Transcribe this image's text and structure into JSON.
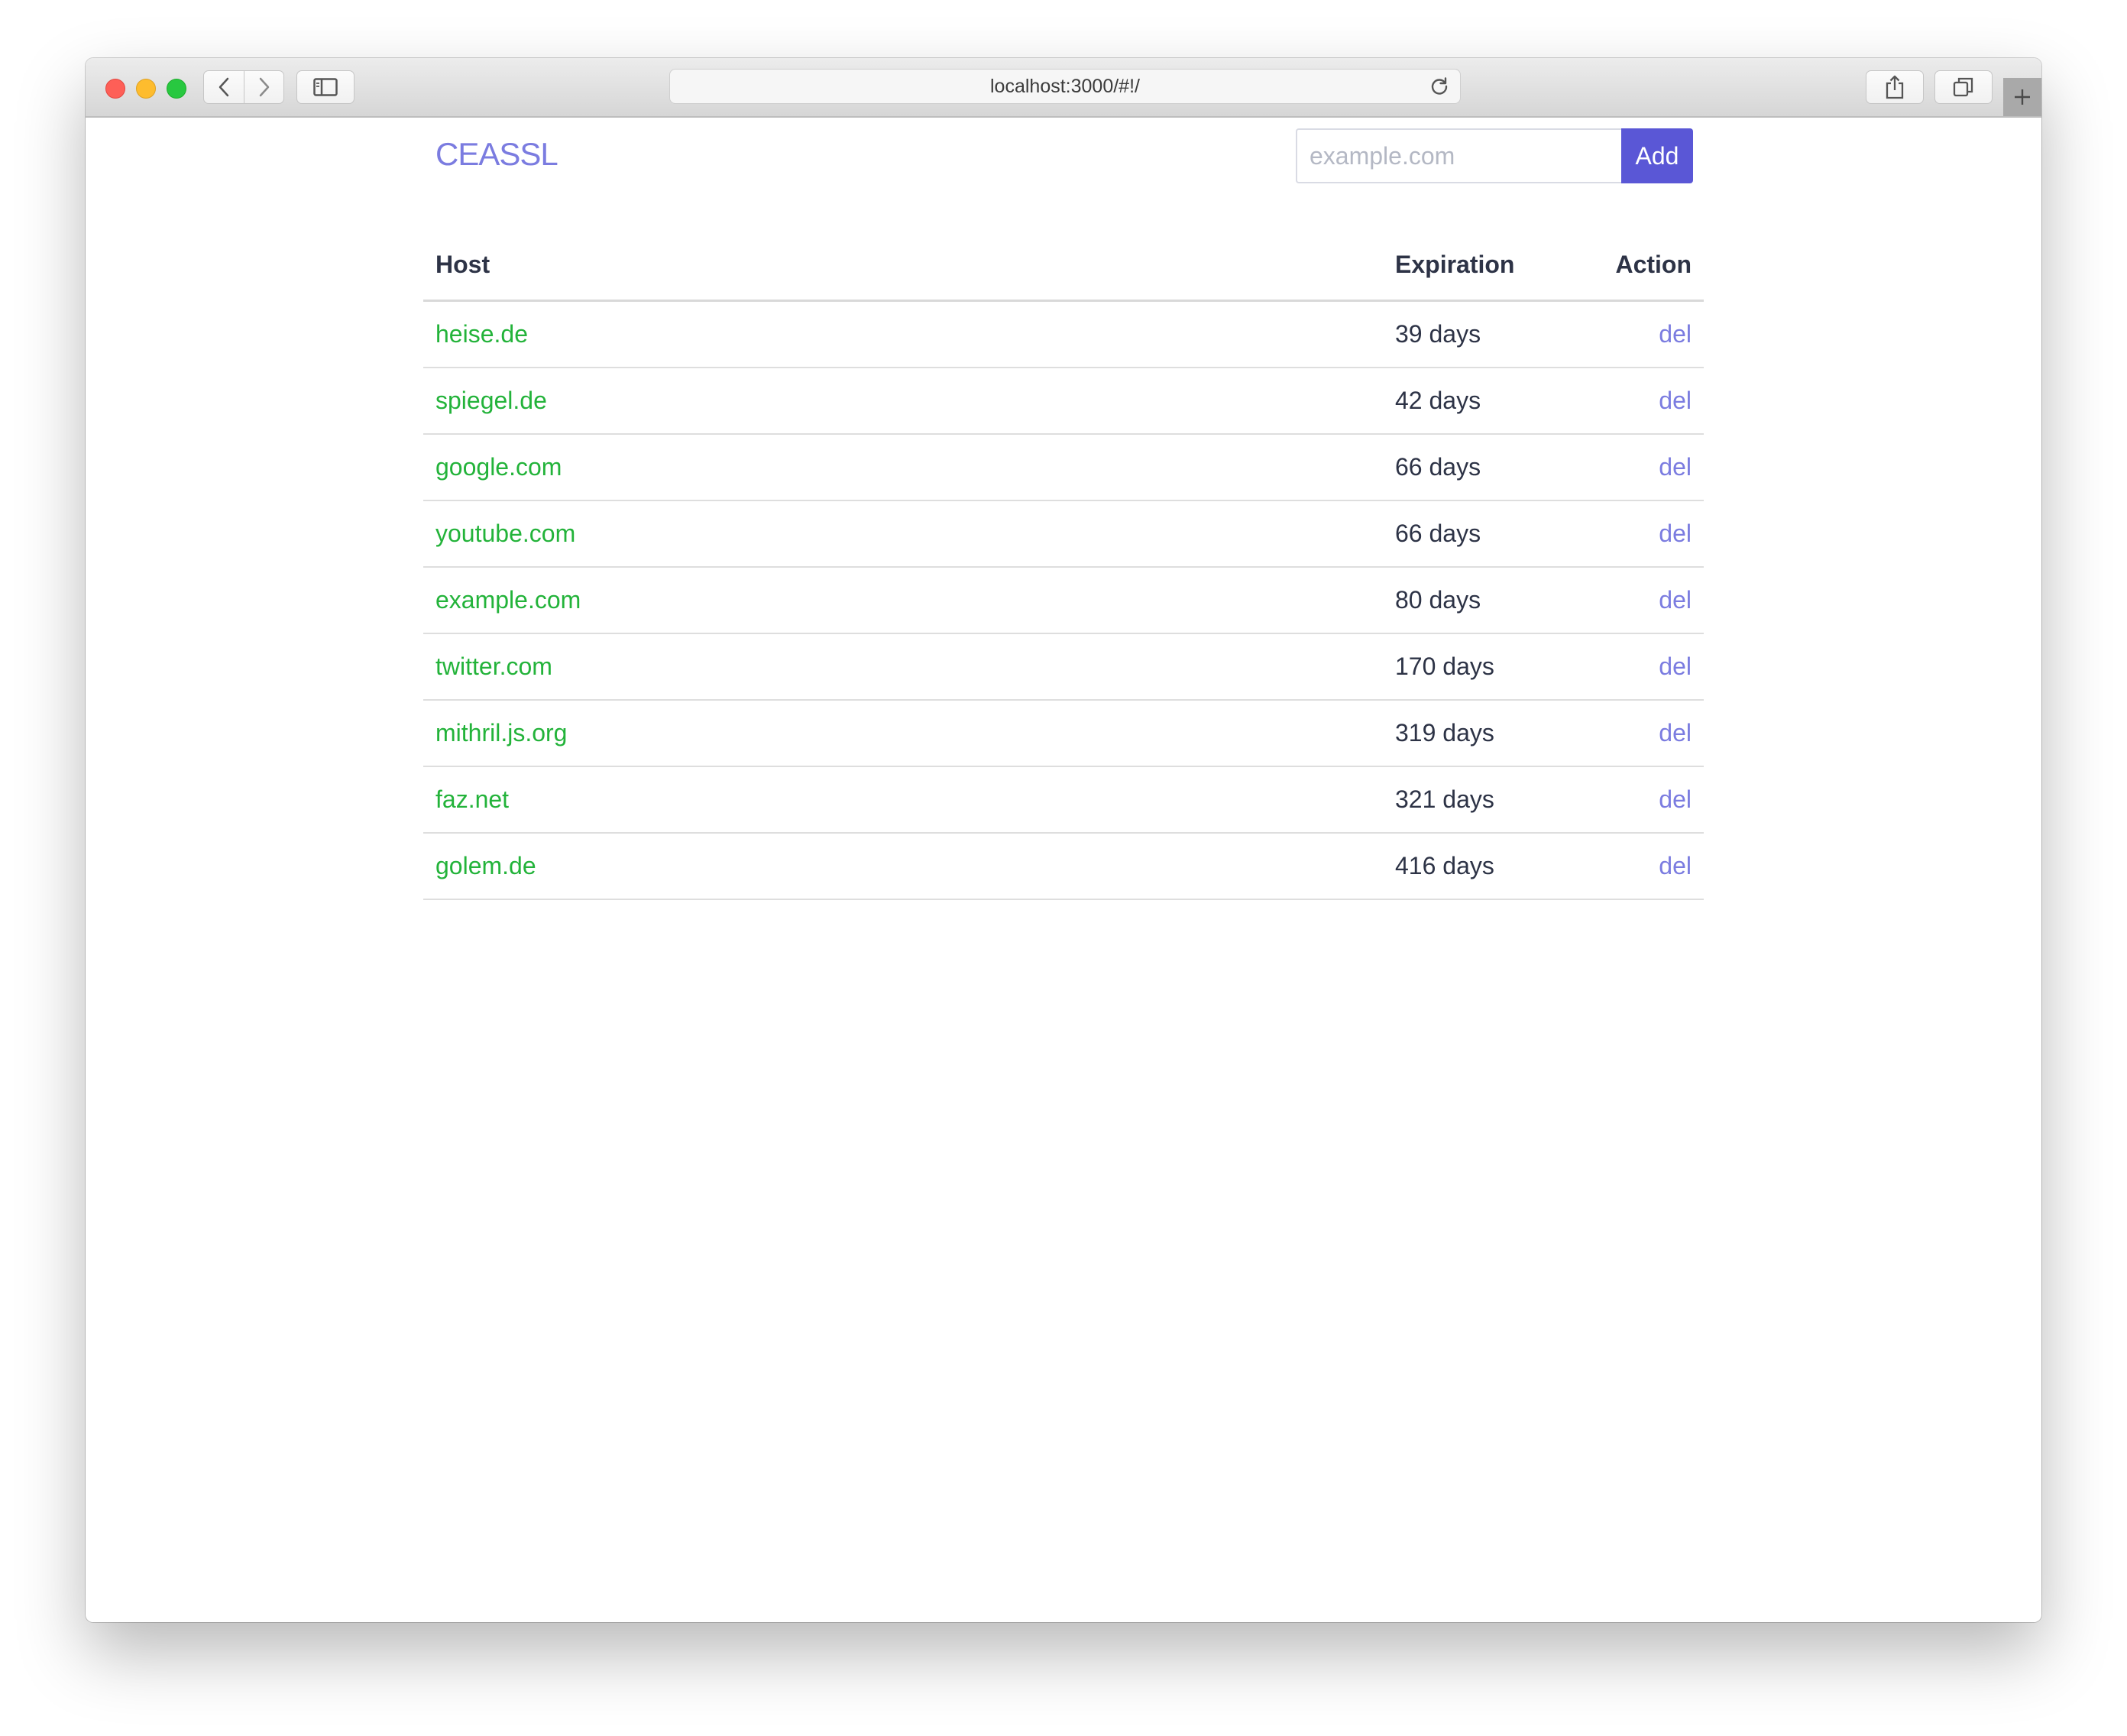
{
  "browser": {
    "url": "localhost:3000/#!/"
  },
  "app": {
    "brand": "CEASSL",
    "add_form": {
      "placeholder": "example.com",
      "value": "",
      "button_label": "Add"
    }
  },
  "table": {
    "headers": {
      "host": "Host",
      "expiration": "Expiration",
      "action": "Action"
    },
    "rows": [
      {
        "host": "heise.de",
        "expiration": "39 days",
        "action": "del"
      },
      {
        "host": "spiegel.de",
        "expiration": "42 days",
        "action": "del"
      },
      {
        "host": "google.com",
        "expiration": "66 days",
        "action": "del"
      },
      {
        "host": "youtube.com",
        "expiration": "66 days",
        "action": "del"
      },
      {
        "host": "example.com",
        "expiration": "80 days",
        "action": "del"
      },
      {
        "host": "twitter.com",
        "expiration": "170 days",
        "action": "del"
      },
      {
        "host": "mithril.js.org",
        "expiration": "319 days",
        "action": "del"
      },
      {
        "host": "faz.net",
        "expiration": "321 days",
        "action": "del"
      },
      {
        "host": "golem.de",
        "expiration": "416 days",
        "action": "del"
      }
    ]
  },
  "colors": {
    "brand": "#7b7ce0",
    "host_link": "#23b33a",
    "add_button": "#5a57d6",
    "text": "#2d3346"
  }
}
